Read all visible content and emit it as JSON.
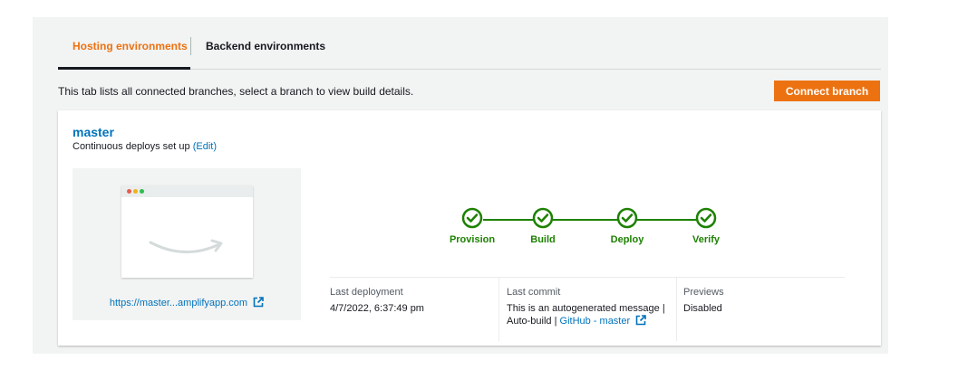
{
  "tabs": [
    {
      "label": "Hosting environments",
      "active": true
    },
    {
      "label": "Backend environments",
      "active": false
    }
  ],
  "description": "This tab lists all connected branches, select a branch to view build details.",
  "connect_button": "Connect branch",
  "branch": {
    "name": "master",
    "deploy_text": "Continuous deploys set up",
    "edit_link": "(Edit)",
    "url": "https://master...amplifyapp.com"
  },
  "pipeline": {
    "stages": [
      "Provision",
      "Build",
      "Deploy",
      "Verify"
    ],
    "status": "success"
  },
  "details": {
    "last_deployment_label": "Last deployment",
    "last_deployment_value": "4/7/2022, 6:37:49 pm",
    "last_commit_label": "Last commit",
    "last_commit_message": "This is an autogenerated message |",
    "last_commit_auto": "Auto-build |",
    "last_commit_link": "GitHub - master",
    "previews_label": "Previews",
    "previews_value": "Disabled"
  },
  "colors": {
    "accent": "#ec7211",
    "link": "#0073bb",
    "success": "#1d8102"
  }
}
